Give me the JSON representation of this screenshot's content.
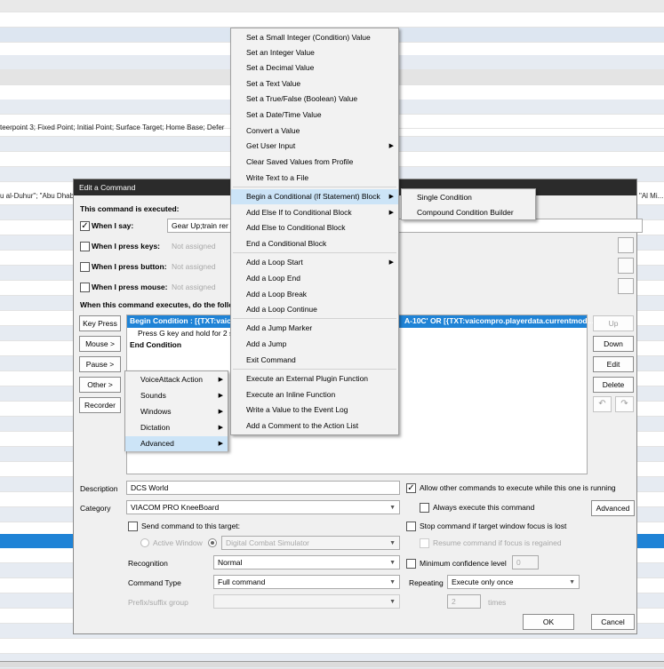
{
  "background": {
    "row_text_1": "teerpoint 3; Fixed Point; Initial Point; Surface Target; Home Base; Defer",
    "row_text_2_left": "u al-Duhur\"; \"Abu Dhab",
    "row_text_2_right": "\"Al Mi..."
  },
  "dialog": {
    "title": "Edit a Command",
    "executed_label": "This command is executed:",
    "when_say_label": "When I say:",
    "when_say_value": "Gear Up;train rer",
    "when_keys_label": "When I press keys:",
    "when_button_label": "When I press button:",
    "when_mouse_label": "When I press mouse:",
    "not_assigned": "Not assigned",
    "actions_label": "When this command executes, do the follov",
    "key_press": "Key Press",
    "mouse": "Mouse >",
    "pause": "Pause >",
    "other": "Other >",
    "recorder": "Recorder",
    "up": "Up",
    "down": "Down",
    "edit": "Edit",
    "delete": "Delete",
    "undo_icon": "undo-icon",
    "redo_icon": "redo-icon",
    "action_lines": [
      "Begin  Condition  :  [{TXT:vaic",
      "Press G key and hold for 2 s",
      "End Condition"
    ],
    "action_line_right": "A-10C'  OR  [{TXT:vaicompro.playerdata.currentmod...",
    "description_label": "Description",
    "description_value": "DCS World",
    "category_label": "Category",
    "category_value": "VIACOM PRO KneeBoard",
    "send_target_label": "Send command to this target:",
    "active_window": "Active Window",
    "target_value": "Digital Combat Simulator",
    "recognition_label": "Recognition",
    "recognition_value": "Normal",
    "command_type_label": "Command Type",
    "command_type_value": "Full command",
    "prefix_label": "Prefix/suffix group",
    "allow_other": "Allow other commands to execute while this one is running",
    "always_execute": "Always execute this command",
    "advanced": "Advanced",
    "stop_command": "Stop command if target window focus is lost",
    "resume_command": "Resume command if focus is regained",
    "min_confidence": "Minimum confidence level",
    "min_confidence_value": "0",
    "repeating_label": "Repeating",
    "repeating_value": "Execute only once",
    "times_value": "2",
    "times_label": "times",
    "ok": "OK",
    "cancel": "Cancel"
  },
  "other_menu": {
    "items": [
      "VoiceAttack Action",
      "Sounds",
      "Windows",
      "Dictation",
      "Advanced"
    ]
  },
  "advanced_menu": {
    "items": [
      "Set a Small Integer (Condition) Value",
      "Set an Integer Value",
      "Set a Decimal Value",
      "Set a Text Value",
      "Set a True/False (Boolean) Value",
      "Set a Date/Time Value",
      "Convert a Value",
      "Get User Input",
      "Clear Saved Values from Profile",
      "Write Text to a File",
      "Begin a Conditional (If Statement) Block",
      "Add Else If to Conditional Block",
      "Add Else to Conditional Block",
      "End a Conditional Block",
      "Add a Loop Start",
      "Add a Loop End",
      "Add a Loop Break",
      "Add a Loop Continue",
      "Add a Jump Marker",
      "Add a Jump",
      "Exit Command",
      "Execute an External Plugin Function",
      "Execute an Inline Function",
      "Write a Value to the Event Log",
      "Add a Comment to the Action List"
    ]
  },
  "condition_submenu": {
    "items": [
      "Single Condition",
      "Compound Condition Builder"
    ]
  }
}
